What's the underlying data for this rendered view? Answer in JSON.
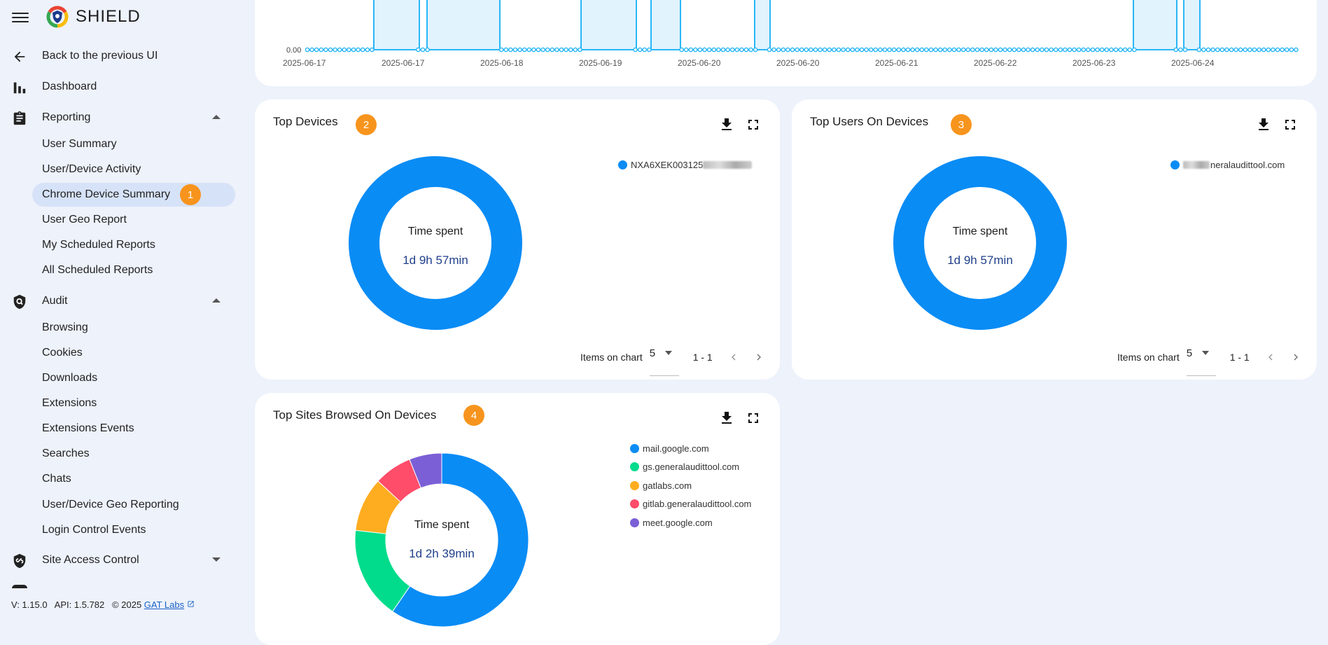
{
  "app": {
    "brand": "SHIELD"
  },
  "topbar": {
    "icons": [
      "menu-icon",
      "user-list-icon",
      "bell-icon",
      "brightness-icon",
      "apps-grid-icon",
      "avatar"
    ]
  },
  "sidebar": {
    "back": "Back to the previous UI",
    "dashboard": "Dashboard",
    "reporting": {
      "label": "Reporting",
      "items": [
        "User Summary",
        "User/Device Activity",
        "Chrome Device Summary",
        "User Geo Report",
        "My Scheduled Reports",
        "All Scheduled Reports"
      ],
      "active_badge": "1"
    },
    "audit": {
      "label": "Audit",
      "items": [
        "Browsing",
        "Cookies",
        "Downloads",
        "Extensions",
        "Extensions Events",
        "Searches",
        "Chats",
        "User/Device Geo Reporting",
        "Login Control Events"
      ]
    },
    "site_access": "Site Access Control",
    "footer": {
      "text": "V: 1.15.0   API: 1.5.782   © 2025",
      "link": "GAT Labs"
    }
  },
  "timeline": {
    "y_tick": "0.00",
    "x_labels": [
      "2025-06-17",
      "2025-06-17",
      "2025-06-18",
      "2025-06-19",
      "2025-06-20",
      "2025-06-20",
      "2025-06-21",
      "2025-06-22",
      "2025-06-23",
      "2025-06-24"
    ],
    "color": "#29b6f6"
  },
  "cards": {
    "top_devices": {
      "title": "Top Devices",
      "badge": "2",
      "center_title": "Time spent",
      "center_value": "1d 9h 57min",
      "legend": [
        "NXA6XEK003125"
      ],
      "items_label": "Items on chart",
      "items_value": "5",
      "range": "1 - 1"
    },
    "top_users": {
      "title": "Top Users On Devices",
      "badge": "3",
      "center_title": "Time spent",
      "center_value": "1d 9h 57min",
      "legend": [
        "neralaudittool.com"
      ],
      "items_label": "Items on chart",
      "items_value": "5",
      "range": "1 - 1"
    },
    "top_sites": {
      "title": "Top Sites Browsed On Devices",
      "badge": "4",
      "center_title": "Time spent",
      "center_value": "1d 2h 39min",
      "legend": [
        "mail.google.com",
        "gs.generalaudittool.com",
        "gatlabs.com",
        "gitlab.generalaudittool.com",
        "meet.google.com"
      ]
    }
  },
  "chart_data": [
    {
      "type": "pie",
      "title": "Top Devices",
      "categories": [
        "NXA6XEK003125"
      ],
      "values": [
        100
      ],
      "colors": [
        "#0a8cf5"
      ]
    },
    {
      "type": "pie",
      "title": "Top Users On Devices",
      "categories": [
        "neralaudittool.com"
      ],
      "values": [
        100
      ],
      "colors": [
        "#0a8cf5"
      ]
    },
    {
      "type": "pie",
      "title": "Top Sites Browsed On Devices",
      "categories": [
        "mail.google.com",
        "gs.generalaudittool.com",
        "gatlabs.com",
        "gitlab.generalaudittool.com",
        "meet.google.com"
      ],
      "values": [
        59,
        17,
        10,
        7,
        6
      ],
      "colors": [
        "#0a8cf5",
        "#00dc8c",
        "#ffad20",
        "#ff4d6a",
        "#7b5fd6"
      ]
    }
  ],
  "colors": {
    "accent": "#0a8cf5",
    "badge": "#f7941d",
    "active_bg": "#d6e2f7",
    "page_bg": "#edf2fb"
  }
}
